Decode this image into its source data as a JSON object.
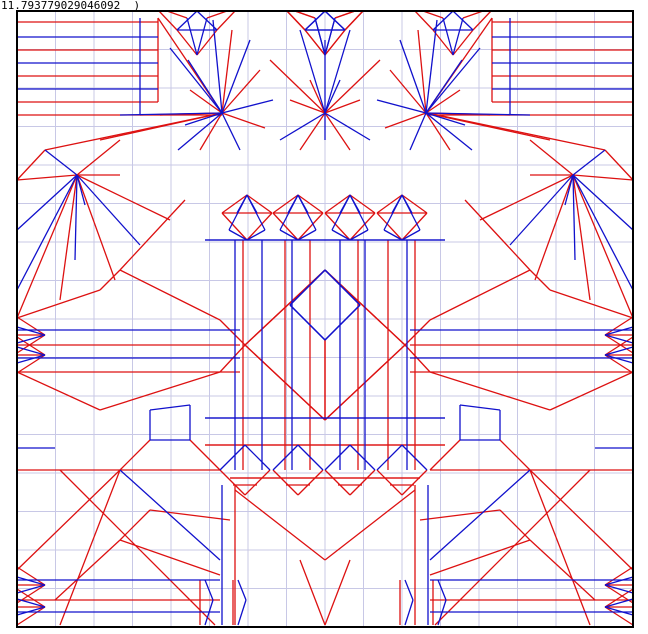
{
  "readout": {
    "text": "11.793779029046092  )"
  },
  "colors": {
    "mountain": "#dd1111",
    "valley": "#1111cc",
    "grid": "#c8c8e6",
    "border": "#000000"
  }
}
